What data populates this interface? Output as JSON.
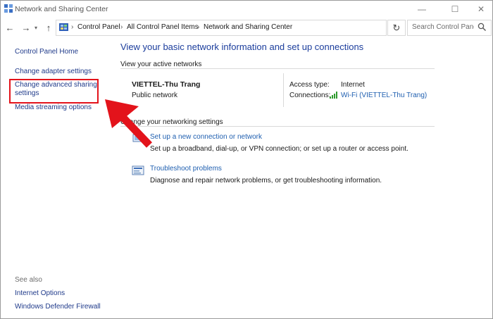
{
  "window": {
    "title": "Network and Sharing Center",
    "min_glyph": "—",
    "max_glyph": "☐",
    "close_glyph": "✕"
  },
  "address_bar": {
    "breadcrumbs": [
      "Control Panel",
      "All Control Panel Items",
      "Network and Sharing Center"
    ],
    "separator": "›",
    "search_placeholder": "Search Control Panel"
  },
  "left_pane": {
    "home": "Control Panel Home",
    "change_adapter": "Change adapter settings",
    "advanced_sharing_line1": "Change advanced sharing",
    "advanced_sharing_line2": "settings",
    "media_streaming": "Media streaming options",
    "see_also": "See also",
    "internet_options": "Internet Options",
    "firewall": "Windows Defender Firewall"
  },
  "main": {
    "title": "View your basic network information and set up connections",
    "active_networks_header": "View your active networks",
    "network": {
      "name": "VIETTEL-Thu Trang",
      "category": "Public network",
      "access_type_label": "Access type:",
      "access_type_value": "Internet",
      "connections_label": "Connections:",
      "connections_value": "Wi-Fi (VIETTEL-Thu Trang)"
    },
    "change_settings_header": "Change your networking settings",
    "tasks": [
      {
        "link": "Set up a new connection or network",
        "description": "Set up a broadband, dial-up, or VPN connection; or set up a router or access point."
      },
      {
        "link": "Troubleshoot problems",
        "description": "Diagnose and repair network problems, or get troubleshooting information."
      }
    ]
  },
  "annotation": {
    "color": "#e3131b",
    "target": "Change advanced sharing settings"
  },
  "colors": {
    "link_blue": "#1f5fb0",
    "title_blue": "#1b3d9c",
    "left_link": "#1f3a8a"
  }
}
